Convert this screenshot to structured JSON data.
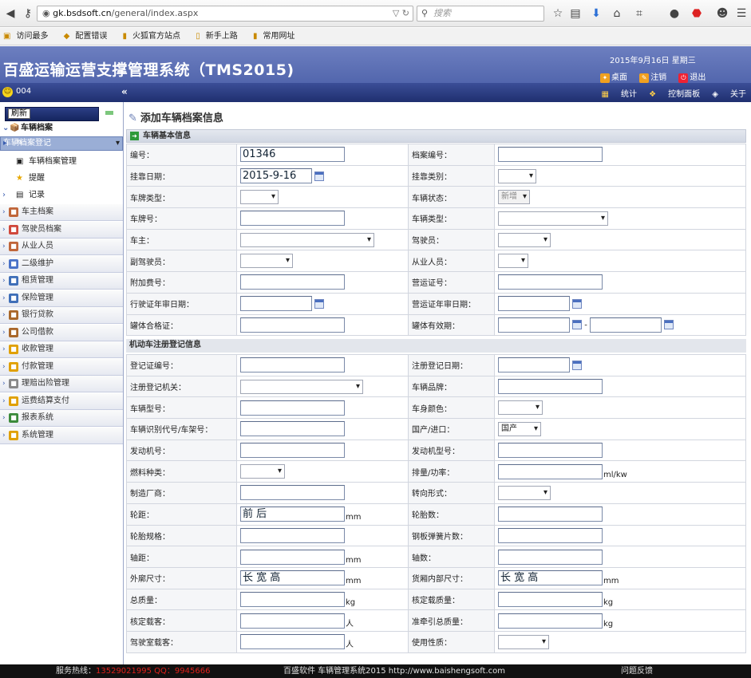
{
  "browser": {
    "url_host": "gk.bsdsoft.cn",
    "url_path": "/general/index.aspx",
    "search_placeholder": "搜索",
    "bookmarks": [
      "访问最多",
      "配置错误",
      "火狐官方站点",
      "新手上路",
      "常用网址"
    ]
  },
  "header": {
    "title": "百盛运输运营支撑管理系统（TMS2015)",
    "date": "2015年9月16日 星期三",
    "links": [
      "桌面",
      "注销",
      "退出"
    ]
  },
  "topbar": {
    "user": "004",
    "collapse": "«",
    "tools": [
      "统计",
      "控制面板",
      "关于"
    ]
  },
  "sidebar": {
    "refresh": "刷新",
    "root": "车辆档案",
    "subitems": [
      "车辆档案登记",
      "车辆档案管理",
      "提醒",
      "记录"
    ],
    "menus": [
      "车主档案",
      "驾驶员档案",
      "从业人员",
      "二级维护",
      "租赁管理",
      "保险管理",
      "银行贷款",
      "公司借款",
      "收款管理",
      "付款管理",
      "理赔出险管理",
      "运费结算支付",
      "报表系统",
      "系统管理"
    ]
  },
  "page": {
    "title": "添加车辆档案信息",
    "section1": "车辆基本信息",
    "section2": "机动车注册登记信息"
  },
  "form1": [
    [
      "编号：",
      "01346",
      "档案编号：",
      ""
    ],
    [
      "挂靠日期：",
      "2015-9-16",
      "挂靠类别：",
      ""
    ],
    [
      "车牌类型：",
      "",
      "车辆状态：",
      "新增"
    ],
    [
      "车牌号：",
      "",
      "车辆类型：",
      ""
    ],
    [
      "车主：",
      "",
      "驾驶员：",
      ""
    ],
    [
      "副驾驶员：",
      "",
      "从业人员：",
      ""
    ],
    [
      "附加费号：",
      "",
      "营运证号：",
      ""
    ],
    [
      "行驶证年审日期：",
      "",
      "营运证年审日期：",
      ""
    ],
    [
      "罐体合格证：",
      "",
      "罐体有效期：",
      ""
    ]
  ],
  "form2": [
    [
      "登记证编号：",
      "",
      "注册登记日期：",
      ""
    ],
    [
      "注册登记机关：",
      "",
      "车辆品牌：",
      ""
    ],
    [
      "车辆型号：",
      "",
      "车身颜色：",
      ""
    ],
    [
      "车辆识别代号/车架号：",
      "",
      "国产/进口：",
      "国产"
    ],
    [
      "发动机号：",
      "",
      "发动机型号：",
      ""
    ],
    [
      "燃料种类：",
      "",
      "排量/功率：",
      ""
    ],
    [
      "制造厂商：",
      "",
      "转向形式：",
      ""
    ],
    [
      "轮距：",
      "前 后",
      "轮胎数：",
      ""
    ],
    [
      "轮胎规格：",
      "",
      "钢板弹簧片数：",
      ""
    ],
    [
      "轴距：",
      "",
      "轴数：",
      ""
    ],
    [
      "外廓尺寸：",
      "长 宽 高",
      "货厢内部尺寸：",
      "长 宽 高"
    ],
    [
      "总质量：",
      "",
      "核定载质量：",
      ""
    ],
    [
      "核定载客：",
      "",
      "准牵引总质量：",
      ""
    ],
    [
      "驾驶室载客：",
      "",
      "使用性质：",
      ""
    ]
  ],
  "units": {
    "mm": "mm",
    "kg": "kg",
    "ren": "人",
    "mlkw": "ml/kw",
    "dash": "-"
  },
  "status": {
    "hotline_label": "服务热线：",
    "hotline": "13529021995   QQ：9945666",
    "center": "百盛软件 车辆管理系统2015 http://www.baishengsoft.com",
    "feedback": "问题反馈"
  }
}
